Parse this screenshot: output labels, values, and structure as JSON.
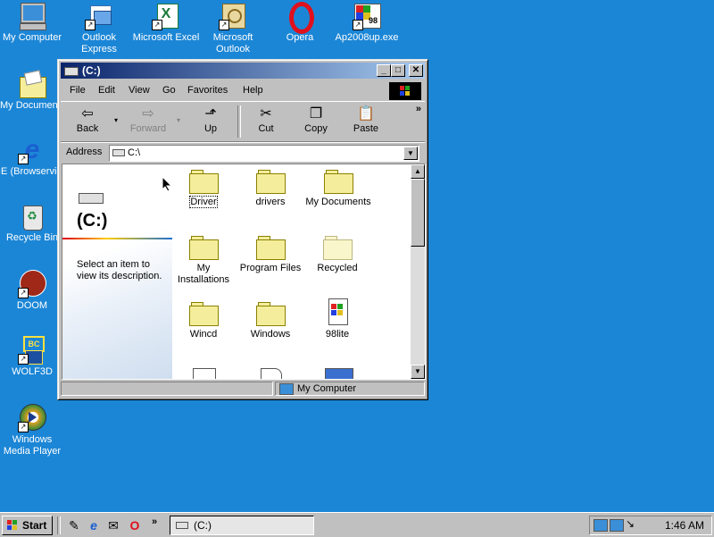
{
  "desktop": {
    "icons": [
      {
        "label": "My Computer",
        "icon": "computer-icon"
      },
      {
        "label": "Outlook Express",
        "icon": "outlook-express-icon"
      },
      {
        "label": "Microsoft Excel",
        "icon": "excel-icon"
      },
      {
        "label": "Microsoft Outlook",
        "icon": "outlook-icon"
      },
      {
        "label": "Opera",
        "icon": "opera-icon"
      },
      {
        "label": "Ap2008up.exe",
        "icon": "installer-icon"
      },
      {
        "label": "My Documents",
        "icon": "documents-folder-icon"
      },
      {
        "label": "IE (Browservice",
        "icon": "ie-icon"
      },
      {
        "label": "Recycle Bin",
        "icon": "recycle-bin-icon"
      },
      {
        "label": "DOOM",
        "icon": "doom-icon"
      },
      {
        "label": "WOLF3D",
        "icon": "wolf3d-icon"
      },
      {
        "label": "Windows Media Player",
        "icon": "media-player-icon"
      }
    ]
  },
  "window": {
    "title": "(C:)",
    "menu": [
      "File",
      "Edit",
      "View",
      "Go",
      "Favorites",
      "Help"
    ],
    "toolbar": {
      "back": "Back",
      "forward": "Forward",
      "up": "Up",
      "cut": "Cut",
      "copy": "Copy",
      "paste": "Paste",
      "more": "»"
    },
    "address": {
      "label": "Address",
      "value": "C:\\"
    },
    "left_panel": {
      "heading": "(C:)",
      "description": "Select an item to view its description."
    },
    "items": [
      {
        "label": "Driver",
        "type": "folder"
      },
      {
        "label": "drivers",
        "type": "folder"
      },
      {
        "label": "My Documents",
        "type": "folder"
      },
      {
        "label": "My Installations",
        "type": "folder"
      },
      {
        "label": "Program Files",
        "type": "folder"
      },
      {
        "label": "Recycled",
        "type": "folder-hidden"
      },
      {
        "label": "Wincd",
        "type": "folder"
      },
      {
        "label": "Windows",
        "type": "folder"
      },
      {
        "label": "98lite",
        "type": "file"
      }
    ],
    "status": {
      "location": "My Computer"
    }
  },
  "taskbar": {
    "start": "Start",
    "task_label": "(C:)",
    "clock": "1:46 AM",
    "more": "»"
  }
}
